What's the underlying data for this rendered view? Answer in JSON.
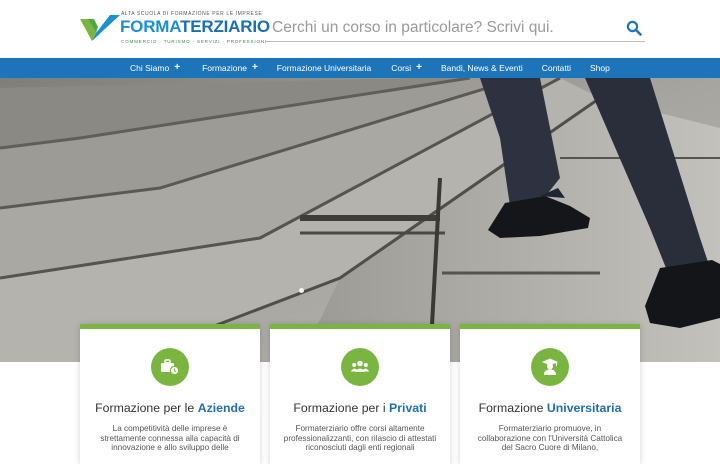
{
  "header": {
    "logo": {
      "tagline": "ALTA SCUOLA DI FORMAZIONE PER LE IMPRESE",
      "name_part1": "FORMA",
      "name_part2": "TERZIARIO",
      "sub": "COMMERCIO · TURISMO · SERVIZI · PROFESSIONI"
    },
    "search": {
      "placeholder": "Cerchi un corso in particolare? Scrivi qui.",
      "icon": "search-icon"
    }
  },
  "nav": {
    "items": [
      {
        "label": "Chi Siamo",
        "plus": "+"
      },
      {
        "label": "Formazione",
        "plus": "+"
      },
      {
        "label": "Formazione Universitaria",
        "plus": ""
      },
      {
        "label": "Corsi",
        "plus": "+"
      },
      {
        "label": "Bandi, News & Eventi",
        "plus": ""
      },
      {
        "label": "Contatti",
        "plus": ""
      },
      {
        "label": "Shop",
        "plus": ""
      }
    ]
  },
  "hero": {
    "image": "person-climbing-stairs-photo",
    "active_slide": 1
  },
  "cards": [
    {
      "icon": "briefcase-clock-icon",
      "title_pre": "Formazione per le ",
      "title_bold": "Aziende",
      "text": "La competitività delle imprese è strettamente connessa alla capacità di innovazione e allo sviluppo delle"
    },
    {
      "icon": "users-group-icon",
      "title_pre": "Formazione per i ",
      "title_bold": "Privati",
      "text": "Formaterziario offre corsi altamente professionalizzanti, con rilascio di attestati riconosciuti dagli enti regionali"
    },
    {
      "icon": "graduate-icon",
      "title_pre": "Formazione ",
      "title_bold": "Universitaria",
      "text": "Formaterziario promuove, in collaborazione con l'Università Cattolica del Sacro Cuore di Milano,"
    }
  ],
  "colors": {
    "nav_blue": "#1d74b8",
    "accent_green": "#7ab541",
    "title_blue": "#1f6fb1"
  }
}
